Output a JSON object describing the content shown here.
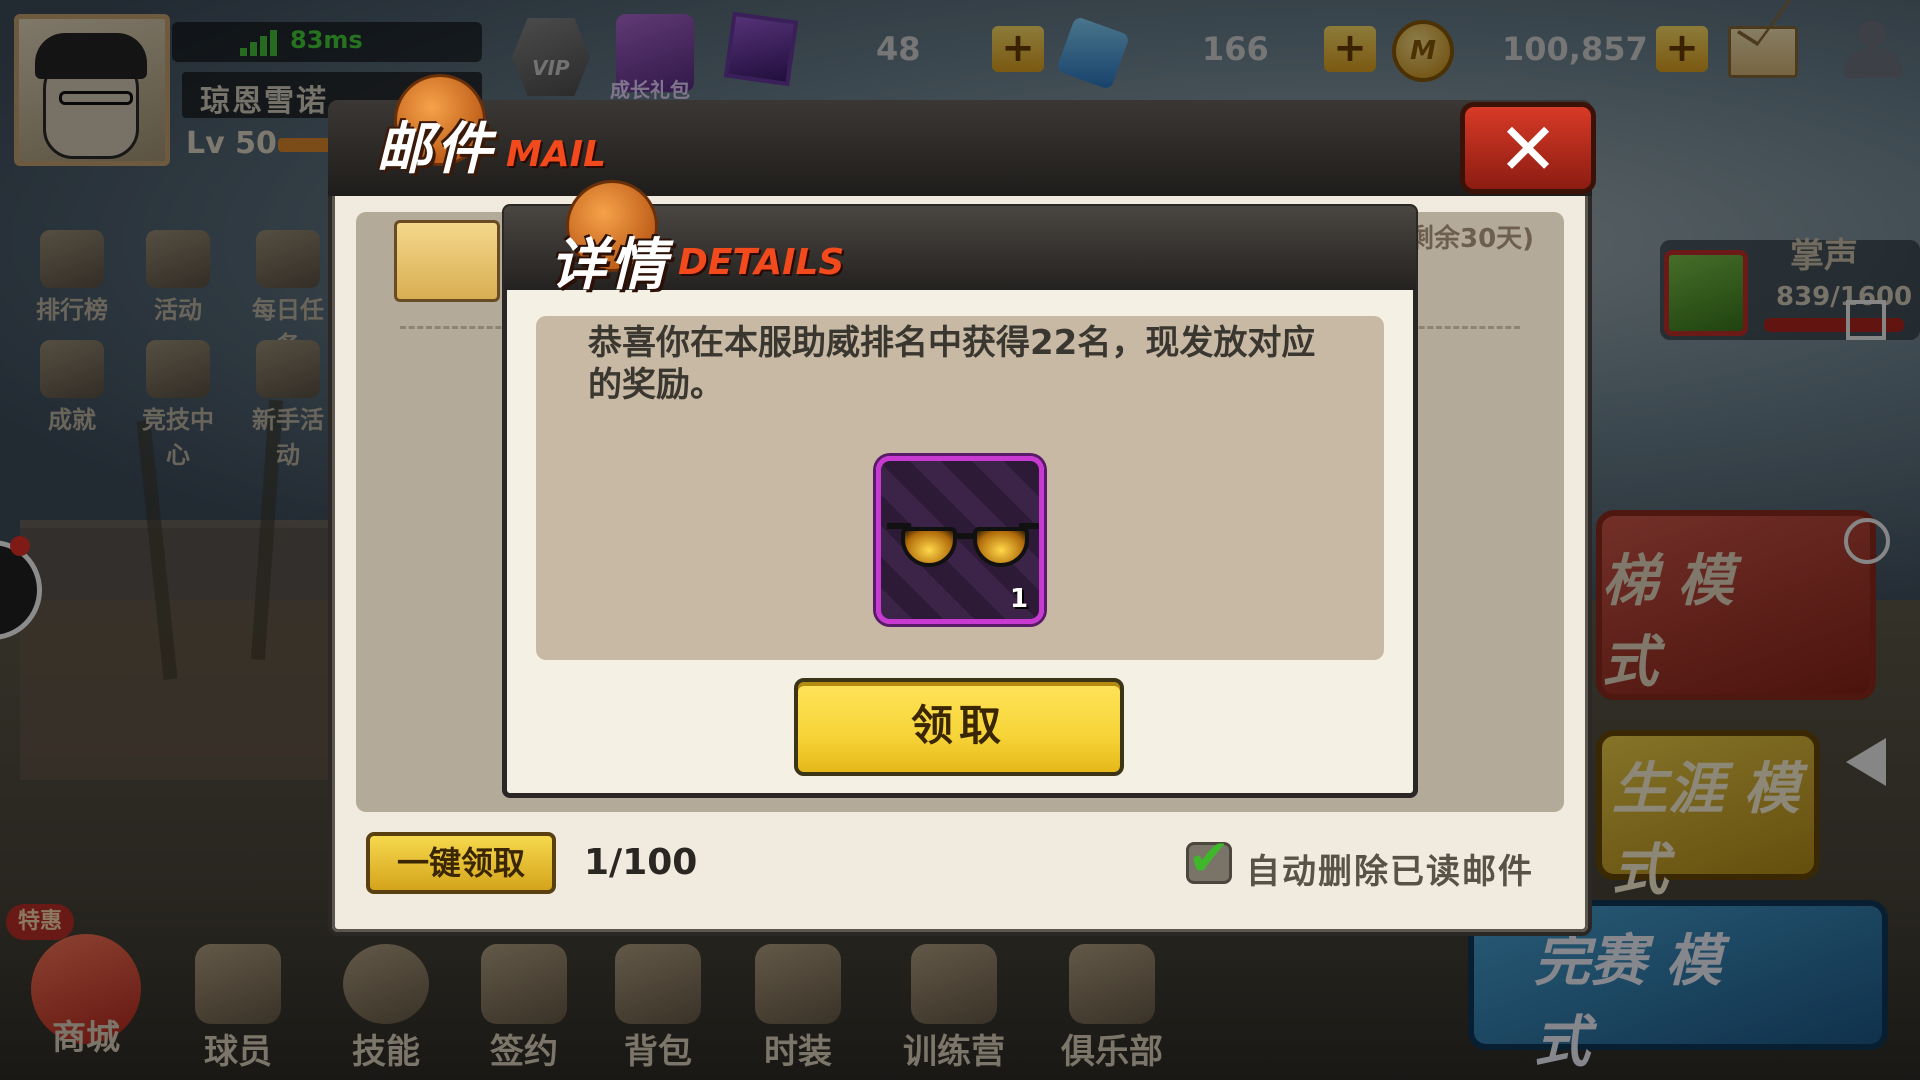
{
  "hud": {
    "ping": "83ms",
    "player_name": "琼恩雪诺",
    "level": "Lv 50",
    "vip_label": "VIP",
    "growth_gift_label": "成长礼包",
    "card_count": "48",
    "gem_count": "166",
    "coin_count": "100,857",
    "coin_symbol": "M",
    "plus": "+"
  },
  "left_menu": [
    {
      "label": "排行榜",
      "icon": "ranking-icon"
    },
    {
      "label": "活动",
      "icon": "event-icon"
    },
    {
      "label": "每日任务",
      "icon": "daily-task-icon"
    },
    {
      "label": "成就",
      "icon": "achievement-icon"
    },
    {
      "label": "竞技中心",
      "icon": "arena-icon"
    },
    {
      "label": "新手活动",
      "icon": "newbie-icon"
    }
  ],
  "right_panel": {
    "applause_label": "掌声",
    "applause_value": "839/1600",
    "modes": [
      "梯 模式",
      "生涯 模式",
      "完赛 模式"
    ]
  },
  "bottom_nav": {
    "sale_badge": "特惠",
    "items": [
      "商城",
      "球员",
      "技能",
      "签约",
      "背包",
      "时装",
      "训练营",
      "俱乐部"
    ]
  },
  "mail": {
    "title_cn": "邮件",
    "title_en": "MAIL",
    "close": "✕",
    "days_left": "剩余30天)",
    "claim_all": "一键领取",
    "count": "1/100",
    "auto_delete_label": "自动删除已读邮件",
    "auto_delete_checked": true
  },
  "details": {
    "title_cn": "详情",
    "title_en": "DETAILS",
    "message": "恭喜你在本服助威排名中获得22名，现发放对应的奖励。",
    "reward": {
      "icon": "sunglasses-icon",
      "quantity": "1"
    },
    "claim_button": "领取"
  },
  "colors": {
    "accent_orange": "#f24a1c",
    "claim_yellow": "#f6d438",
    "reward_border": "#c83ad2",
    "ping_green": "#46d23a"
  }
}
